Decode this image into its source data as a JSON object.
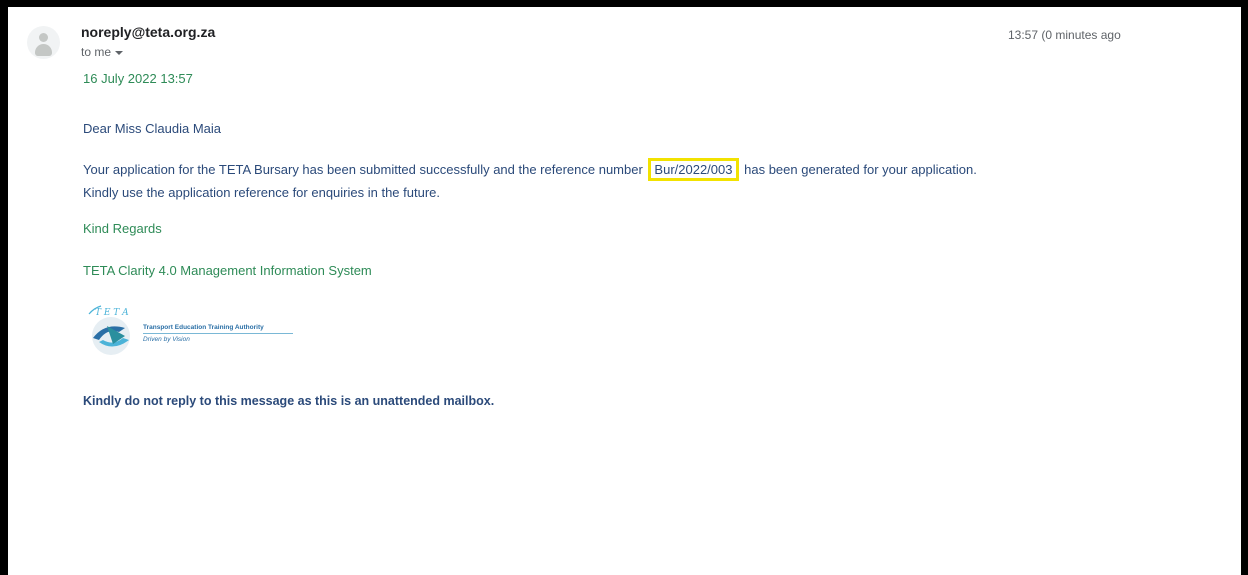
{
  "header": {
    "sender": "noreply@teta.org.za",
    "recipient_line": "to me",
    "timestamp": "13:57 (0 minutes ago"
  },
  "email": {
    "date_line": "16 July 2022 13:57",
    "greeting": "Dear Miss Claudia Maia",
    "body_before_ref": "Your application for the TETA Bursary has been submitted successfully and the reference number",
    "reference_number": "Bur/2022/003",
    "body_after_ref": "has been generated for your application.",
    "body_line2": "Kindly use the application reference for enquiries in the future.",
    "sign_off": "Kind Regards",
    "system_name": "TETA Clarity 4.0 Management Information System",
    "footer_note": "Kindly do not reply to this message as this is an unattended mailbox."
  },
  "logo": {
    "letters": "T E T A",
    "org_name": "Transport Education Training Authority",
    "tagline": "Driven by Vision"
  },
  "colors": {
    "body_text": "#2b4a7a",
    "green_text": "#2e8b57",
    "highlight_border": "#f2e200",
    "logo_blue": "#2a6fa6"
  }
}
